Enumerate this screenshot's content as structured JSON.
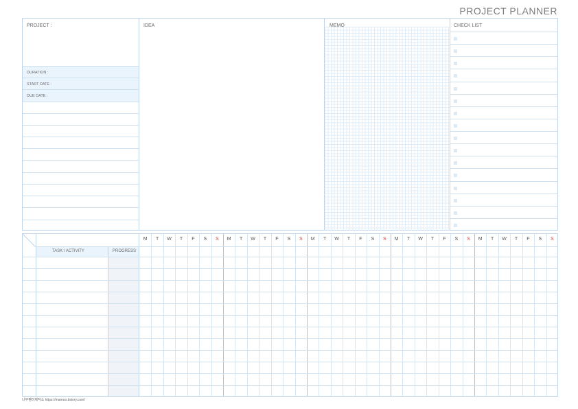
{
  "title": "PROJECT PLANNER",
  "sections": {
    "project": "PROJECT :",
    "idea": "IDEA",
    "memo": "MEMO",
    "checklist": "CHECK LIST"
  },
  "project_fields": {
    "duration": "DURATION :",
    "start_date": "START DATE :",
    "due_date": "DUE DATE :"
  },
  "table": {
    "task_header": "TASK / ACTIVITY",
    "progress_header": "PROGRESS",
    "weekdays": [
      "M",
      "T",
      "W",
      "T",
      "F",
      "S",
      "S"
    ],
    "weeks": 5,
    "rows": 12
  },
  "checklist_items": 16,
  "colors": {
    "border": "#bfd4e8",
    "band": "#eaf4fd",
    "sunday": "#e0443a"
  },
  "footer": "나무펭이제작소  https://mamoo.tistory.com/"
}
